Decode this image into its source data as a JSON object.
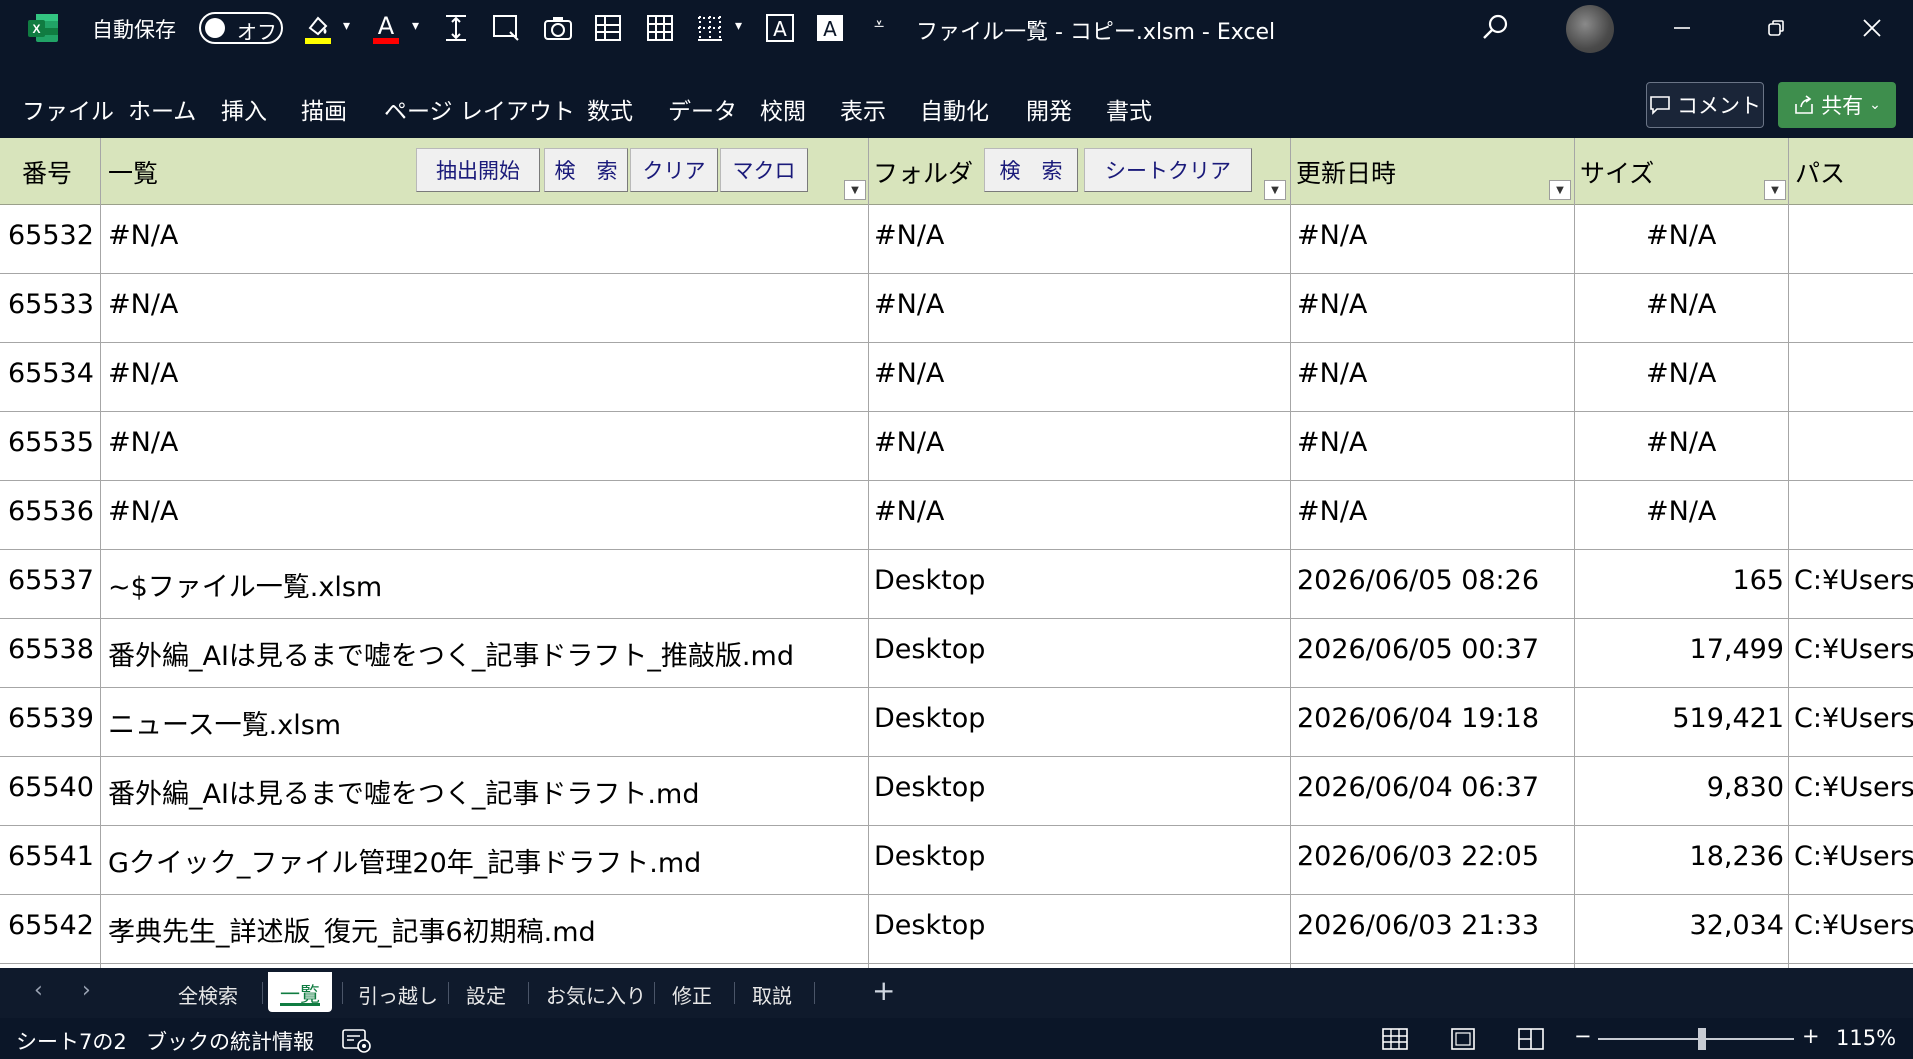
{
  "titlebar": {
    "autosave_label": "自動保存",
    "autosave_state": "オフ",
    "doc_title": "ファイル一覧 - コピー.xlsm  -  Excel",
    "qat_icons": [
      "fill-color-icon",
      "font-color-icon",
      "row-height-icon",
      "select-range-icon",
      "camera-icon",
      "freeze-panes-icon",
      "grid-icon",
      "borders-icon",
      "text-box-icon",
      "text-box-filled-icon",
      "customize-qat-icon"
    ],
    "colors": {
      "background": "#0b1628",
      "fill_bar": "#ffff00",
      "font_bar": "#ff0000"
    }
  },
  "ribbon": {
    "tabs": [
      "ファイル",
      "ホーム",
      "挿入",
      "描画",
      "ページ レイアウト",
      "数式",
      "データ",
      "校閲",
      "表示",
      "自動化",
      "開発",
      "書式"
    ],
    "comment_label": "コメント",
    "share_label": "共有",
    "colors": {
      "share": "#3e8e4d"
    }
  },
  "sheet": {
    "headers": {
      "num": "番号",
      "list": "一覧",
      "folder": "フォルダ",
      "updated": "更新日時",
      "size": "サイズ",
      "path": "パス"
    },
    "buttons": {
      "extract": "抽出開始",
      "search1": "検　索",
      "clear": "クリア",
      "macro": "マクロ",
      "search2": "検　索",
      "sheet_clear": "シートクリア"
    },
    "header_color": "#d8e4bc",
    "rows": [
      {
        "num": "65532",
        "name": "#N/A",
        "folder": "#N/A",
        "date": "#N/A",
        "size": "#N/A",
        "path": ""
      },
      {
        "num": "65533",
        "name": "#N/A",
        "folder": "#N/A",
        "date": "#N/A",
        "size": "#N/A",
        "path": ""
      },
      {
        "num": "65534",
        "name": "#N/A",
        "folder": "#N/A",
        "date": "#N/A",
        "size": "#N/A",
        "path": ""
      },
      {
        "num": "65535",
        "name": "#N/A",
        "folder": "#N/A",
        "date": "#N/A",
        "size": "#N/A",
        "path": ""
      },
      {
        "num": "65536",
        "name": "#N/A",
        "folder": "#N/A",
        "date": "#N/A",
        "size": "#N/A",
        "path": ""
      },
      {
        "num": "65537",
        "name": "~$ファイル一覧.xlsm",
        "folder": "Desktop",
        "date": "2026/06/05 08:26",
        "size": "165",
        "path": "C:¥Users"
      },
      {
        "num": "65538",
        "name": "番外編_AIは見るまで嘘をつく_記事ドラフト_推敲版.md",
        "folder": "Desktop",
        "date": "2026/06/05 00:37",
        "size": "17,499",
        "path": "C:¥Users"
      },
      {
        "num": "65539",
        "name": "ニュース一覧.xlsm",
        "folder": "Desktop",
        "date": "2026/06/04 19:18",
        "size": "519,421",
        "path": "C:¥Users"
      },
      {
        "num": "65540",
        "name": "番外編_AIは見るまで嘘をつく_記事ドラフト.md",
        "folder": "Desktop",
        "date": "2026/06/04 06:37",
        "size": "9,830",
        "path": "C:¥Users"
      },
      {
        "num": "65541",
        "name": "Gクイック_ファイル管理20年_記事ドラフト.md",
        "folder": "Desktop",
        "date": "2026/06/03 22:05",
        "size": "18,236",
        "path": "C:¥Users"
      },
      {
        "num": "65542",
        "name": "孝典先生_詳述版_復元_記事6初期稿.md",
        "folder": "Desktop",
        "date": "2026/06/03 21:33",
        "size": "32,034",
        "path": "C:¥Users"
      }
    ]
  },
  "sheet_tabs": {
    "tabs": [
      "全検索",
      "一覧",
      "引っ越し",
      "設定",
      "お気に入り",
      "修正",
      "取説"
    ],
    "active": "一覧",
    "add_label": "+"
  },
  "status": {
    "sheet_pos": "シート7の2",
    "stats": "ブックの統計情報",
    "zoom_minus": "−",
    "zoom_plus": "+",
    "zoom": "115%",
    "zoom_level_fraction": 0.53
  }
}
